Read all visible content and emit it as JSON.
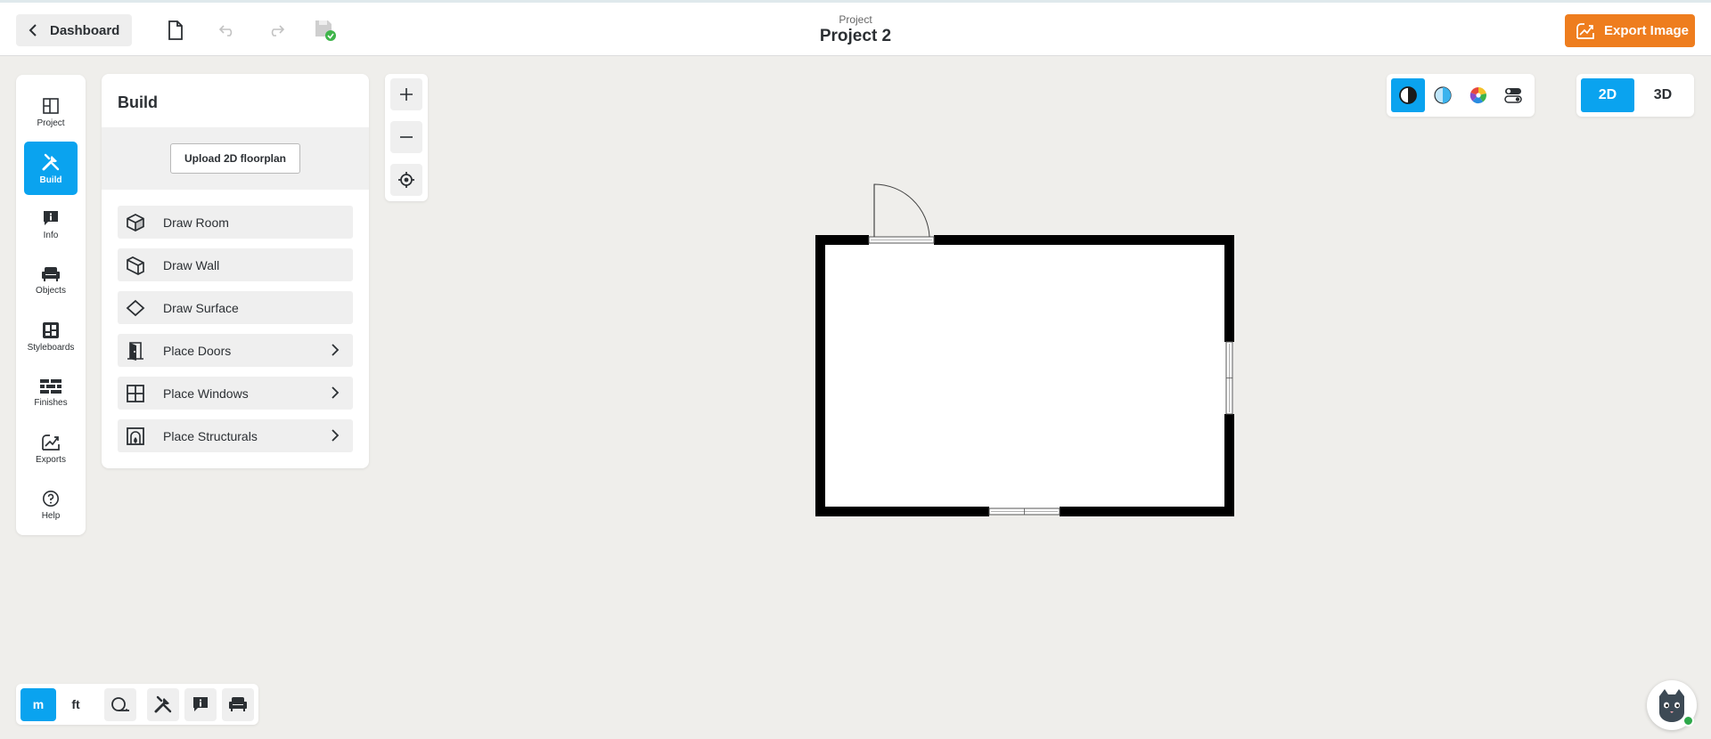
{
  "header": {
    "dashboard_label": "Dashboard",
    "project_label": "Project",
    "project_name": "Project 2",
    "export_label": "Export Image"
  },
  "sidebar": {
    "items": [
      {
        "label": "Project",
        "icon": "layout-icon"
      },
      {
        "label": "Build",
        "icon": "tools-icon",
        "active": true
      },
      {
        "label": "Info",
        "icon": "info-chat-icon"
      },
      {
        "label": "Objects",
        "icon": "sofa-icon"
      },
      {
        "label": "Styleboards",
        "icon": "styleboard-icon"
      },
      {
        "label": "Finishes",
        "icon": "brick-icon"
      },
      {
        "label": "Exports",
        "icon": "export-icon"
      },
      {
        "label": "Help",
        "icon": "help-icon"
      }
    ]
  },
  "build_panel": {
    "title": "Build",
    "upload_label": "Upload 2D floorplan",
    "tools": [
      {
        "label": "Draw Room",
        "icon": "cube-icon",
        "has_submenu": false
      },
      {
        "label": "Draw Wall",
        "icon": "wall-icon",
        "has_submenu": false
      },
      {
        "label": "Draw Surface",
        "icon": "surface-icon",
        "has_submenu": false
      },
      {
        "label": "Place Doors",
        "icon": "door-icon",
        "has_submenu": true
      },
      {
        "label": "Place Windows",
        "icon": "window-icon",
        "has_submenu": true
      },
      {
        "label": "Place Structurals",
        "icon": "fireplace-icon",
        "has_submenu": true
      }
    ]
  },
  "view_modes": {
    "render_modes": [
      "contrast-icon",
      "halftone-icon",
      "color-wheel-icon",
      "toggles-icon"
    ],
    "active_render": 0,
    "dimension_modes": [
      "2D",
      "3D"
    ],
    "active_dimension": "2D"
  },
  "bottom_bar": {
    "units": [
      "m",
      "ft"
    ],
    "active_unit": "m",
    "tools": [
      "measure-tape-icon",
      "tools-icon",
      "info-chat-icon",
      "sofa-icon"
    ]
  },
  "colors": {
    "accent": "#0aa3ef",
    "export": "#ee7d1e",
    "canvas": "#efeeeb",
    "online": "#2ea84a"
  }
}
